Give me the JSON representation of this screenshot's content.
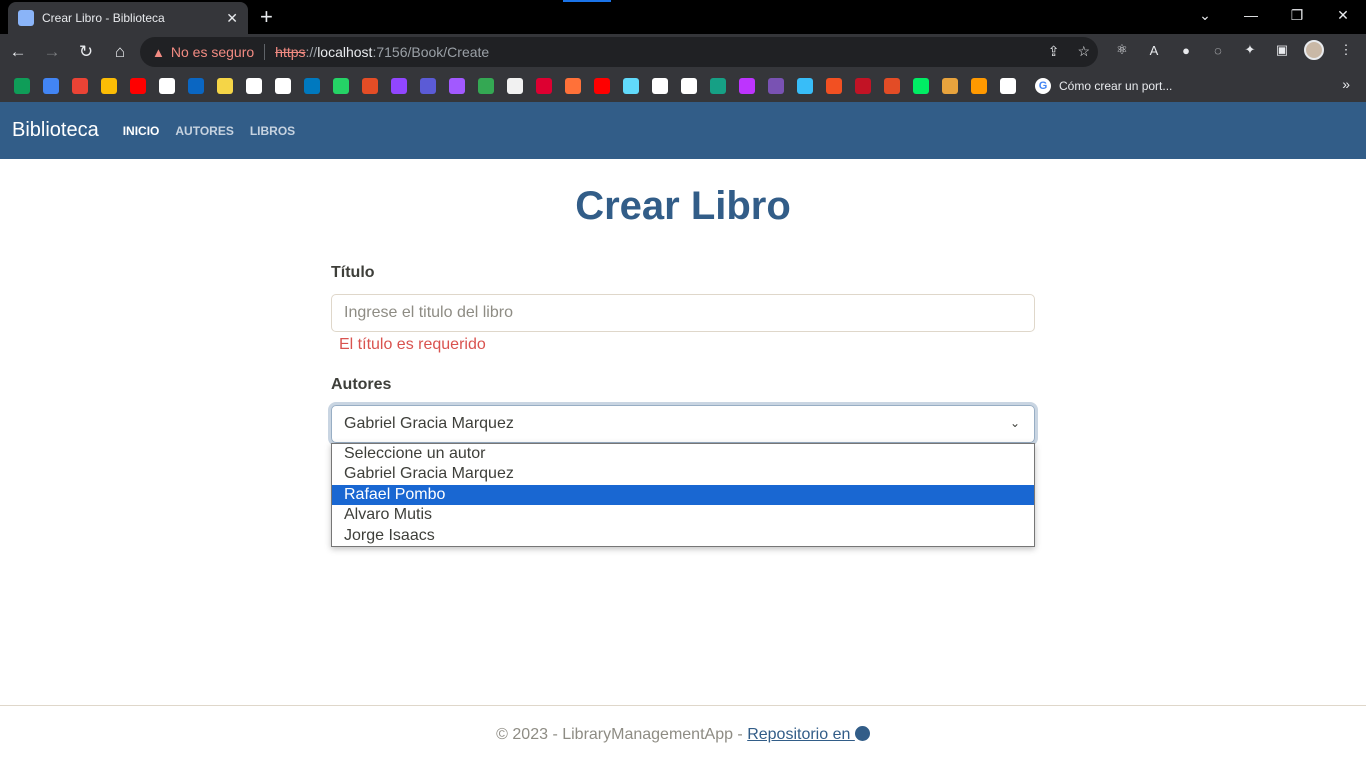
{
  "browser": {
    "tab_title": "Crear Libro - Biblioteca",
    "tab_close": "✕",
    "new_tab": "+",
    "security_label": "No es seguro",
    "url_scheme": "https",
    "url_sep": "://",
    "url_host": "localhost",
    "url_rest": ":7156/Book/Create",
    "bookmark_last": "Cómo crear un port...",
    "bookmark_colors": [
      "#0f9d58",
      "#4285f4",
      "#ea4335",
      "#fbbc05",
      "#ff0000",
      "#ffffff",
      "#0a66c2",
      "#f5d547",
      "#ffffff",
      "#ffffff",
      "#0079bf",
      "#25d366",
      "#e44d26",
      "#9146ff",
      "#5b5bd6",
      "#a259ff",
      "#34a853",
      "#f1f1f1",
      "#dd0031",
      "#ff7139",
      "#ff0000",
      "#61dafb",
      "#ffffff",
      "#ffffff",
      "#16a085",
      "#bd34fe",
      "#7952b3",
      "#38bdf8",
      "#f25022",
      "#c21325",
      "#e34c26",
      "#00ed64",
      "#e8a33d",
      "#ff9900",
      "#ffffff"
    ]
  },
  "app": {
    "brand": "Biblioteca",
    "nav": [
      {
        "label": "INICIO",
        "active": true
      },
      {
        "label": "AUTORES",
        "active": false
      },
      {
        "label": "LIBROS",
        "active": false
      }
    ]
  },
  "form": {
    "page_title": "Crear Libro",
    "title_label": "Título",
    "title_placeholder": "Ingrese el titulo del libro",
    "title_error": "El título es requerido",
    "authors_label": "Autores",
    "authors_selected": "Gabriel Gracia Marquez",
    "authors_options": [
      "Seleccione un autor",
      "Gabriel Gracia Marquez",
      "Rafael Pombo",
      "Alvaro Mutis",
      "Jorge Isaacs"
    ],
    "highlighted_option": "Rafael Pombo"
  },
  "footer": {
    "text": "© 2023 - LibraryManagementApp - ",
    "link_text": "Repositorio en "
  }
}
